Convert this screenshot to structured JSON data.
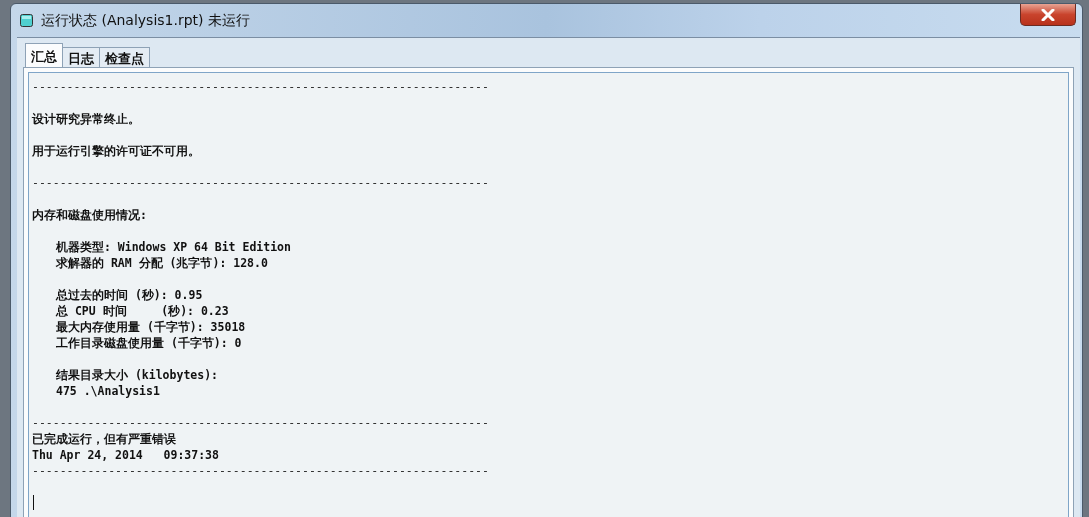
{
  "window": {
    "title": "运行状态 (Analysis1.rpt) 未运行"
  },
  "tabs": [
    {
      "label": "汇总",
      "selected": true
    },
    {
      "label": "日志",
      "selected": false
    },
    {
      "label": "检查点",
      "selected": false
    }
  ],
  "report": {
    "lines": [
      {
        "kind": "rule",
        "text": "------------------------------------------------------------------"
      },
      {
        "kind": "blank"
      },
      {
        "kind": "text",
        "text": "设计研究异常终止。"
      },
      {
        "kind": "blank"
      },
      {
        "kind": "text",
        "text": "用于运行引擎的许可证不可用。"
      },
      {
        "kind": "blank"
      },
      {
        "kind": "rule",
        "text": "------------------------------------------------------------------"
      },
      {
        "kind": "blank"
      },
      {
        "kind": "text",
        "text": "内存和磁盘使用情况:"
      },
      {
        "kind": "blank"
      },
      {
        "kind": "indent",
        "children": [
          {
            "kind": "text",
            "text": "机器类型: Windows XP 64 Bit Edition"
          },
          {
            "kind": "text",
            "text": "求解器的 RAM 分配 (兆字节): 128.0"
          },
          {
            "kind": "blank"
          },
          {
            "kind": "text",
            "text": "总过去的时间 (秒): 0.95"
          },
          {
            "kind": "text",
            "text": "总 CPU 时间     (秒): 0.23"
          },
          {
            "kind": "text",
            "text": "最大内存使用量 (千字节): 35018"
          },
          {
            "kind": "text",
            "text": "工作目录磁盘使用量 (千字节): 0"
          },
          {
            "kind": "blank"
          },
          {
            "kind": "text",
            "text": "结果目录大小 (kilobytes):"
          },
          {
            "kind": "text",
            "text": "475 .\\Analysis1"
          }
        ]
      },
      {
        "kind": "blank"
      },
      {
        "kind": "rule",
        "text": "------------------------------------------------------------------"
      },
      {
        "kind": "text",
        "text": "已完成运行，但有严重错误"
      },
      {
        "kind": "text",
        "text": "Thu Apr 24, 2014   09:37:38"
      },
      {
        "kind": "rule",
        "text": "------------------------------------------------------------------"
      },
      {
        "kind": "blank"
      },
      {
        "kind": "cursor"
      }
    ]
  }
}
